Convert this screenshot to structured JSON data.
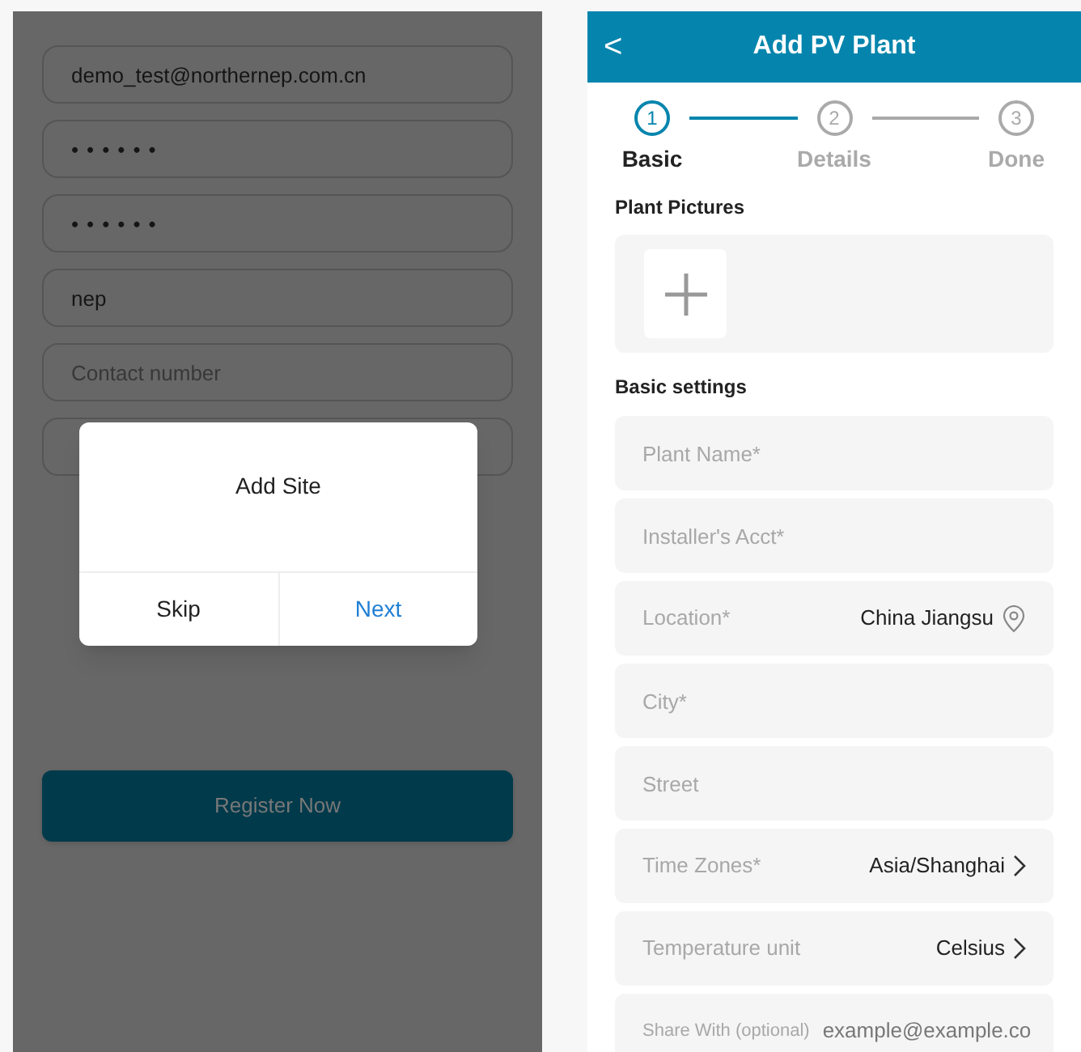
{
  "registration": {
    "fields": [
      {
        "kind": "text",
        "value": "demo_test@northernep.com.cn"
      },
      {
        "kind": "password",
        "value": "••••••"
      },
      {
        "kind": "password",
        "value": "••••••"
      },
      {
        "kind": "text",
        "value": "nep"
      },
      {
        "kind": "text",
        "placeholder": "Contact number"
      },
      {
        "kind": "text"
      }
    ],
    "register_button": "Register Now"
  },
  "dialog": {
    "title": "Add Site",
    "buttons": [
      {
        "label": "Skip",
        "primary": false
      },
      {
        "label": "Next",
        "primary": true
      }
    ]
  },
  "add_plant": {
    "title": "Add PV Plant",
    "back": "<",
    "steps": [
      {
        "number": "1",
        "label": "Basic",
        "selected": true
      },
      {
        "number": "2",
        "label": "Details",
        "selected": false
      },
      {
        "number": "3",
        "label": "Done",
        "selected": false
      }
    ],
    "pictures_title": "Plant Pictures",
    "settings_title": "Basic settings",
    "rows": [
      {
        "kind": "input",
        "placeholder": "Plant Name*"
      },
      {
        "kind": "input",
        "placeholder": "Installer's Acct*"
      },
      {
        "kind": "location",
        "label": "Location*",
        "value": "China Jiangsu"
      },
      {
        "kind": "input",
        "placeholder": "City*"
      },
      {
        "kind": "input",
        "placeholder": "Street"
      },
      {
        "kind": "select",
        "label": "Time Zones*",
        "value": "Asia/Shanghai"
      },
      {
        "kind": "select",
        "label": "Temperature unit",
        "value": "Celsius"
      },
      {
        "kind": "labeled_input",
        "label": "Share With (optional)",
        "placeholder": "example@example.co"
      }
    ]
  }
}
